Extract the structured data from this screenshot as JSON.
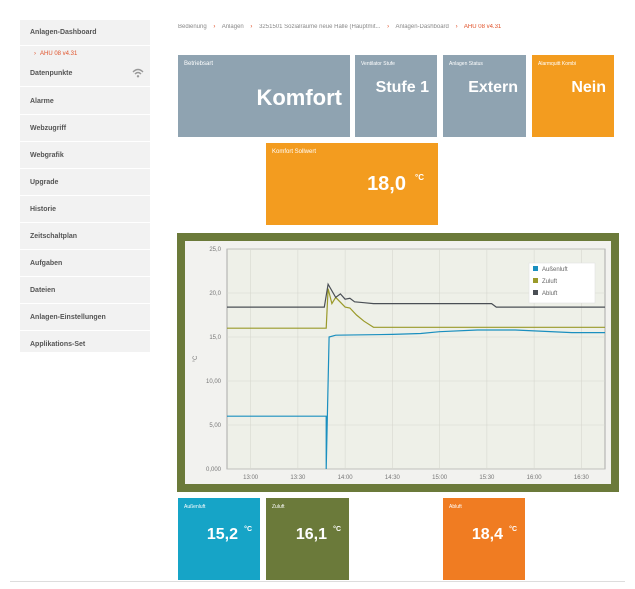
{
  "sidebar": {
    "items": [
      {
        "label": "Anlagen-Dashboard"
      },
      {
        "label": "AHU 08 v4.31",
        "sub": true
      },
      {
        "label": "Datenpunkte",
        "icon": "wifi-icon"
      },
      {
        "label": "Alarme"
      },
      {
        "label": "Webzugriff"
      },
      {
        "label": "Webgrafik"
      },
      {
        "label": "Upgrade"
      },
      {
        "label": "Historie"
      },
      {
        "label": "Zeitschaltplan"
      },
      {
        "label": "Aufgaben"
      },
      {
        "label": "Dateien"
      },
      {
        "label": "Anlagen-Einstellungen"
      },
      {
        "label": "Applikations-Set"
      }
    ]
  },
  "breadcrumb": {
    "items": [
      "Bedienung",
      "Anlagen",
      "3251501 Sozialräume neue Halle (Hauptmit...",
      "Anlagen-Dashboard",
      "AHU 08 v4.31"
    ]
  },
  "tiles": {
    "betriebsart": {
      "label": "Betriebsart",
      "value": "Komfort"
    },
    "luefter": {
      "label": "Ventilator Stufe",
      "value": "Stufe 1"
    },
    "anlagenstatus": {
      "label": "Anlagen Status",
      "value": "Extern"
    },
    "alarm": {
      "label": "Alarmquitt Kombi",
      "value": "Nein"
    },
    "sollwert": {
      "label": "Komfort Sollwert",
      "value": "18,0",
      "unit": "°C"
    },
    "aussenluft": {
      "label": "Außenluft",
      "value": "15,2",
      "unit": "°C"
    },
    "zuluft": {
      "label": "Zuluft",
      "value": "16,1",
      "unit": "°C"
    },
    "abluft": {
      "label": "Abluft",
      "value": "18,4",
      "unit": "°C"
    }
  },
  "colors": {
    "grey_tile": "#8fa3b1",
    "orange": "#f39c1f",
    "blue": "#16a4c7",
    "olive": "#6b7a3a",
    "dark_orange": "#f07c22",
    "accent_red": "#e0522a"
  },
  "chart_data": {
    "type": "line",
    "ylabel": "°C",
    "y_ticks": [
      "0,000",
      "5,00",
      "10,00",
      "15,0",
      "20,0",
      "25,0"
    ],
    "ylim": [
      0,
      25
    ],
    "x_ticks": [
      "13:00",
      "13:30",
      "14:00",
      "14:30",
      "15:00",
      "15:30",
      "16:00",
      "16:30"
    ],
    "xlim": [
      12.75,
      16.75
    ],
    "grid": true,
    "legend_position": "top-right",
    "series": [
      {
        "name": "Außenluft",
        "color": "#1a8fbf",
        "x": [
          12.75,
          13.75,
          13.8,
          13.8,
          13.83,
          13.9,
          14.5,
          14.8,
          15.0,
          15.4,
          15.8,
          16.4,
          16.75
        ],
        "y": [
          6.0,
          6.0,
          6.0,
          0.0,
          15.0,
          15.2,
          15.3,
          15.4,
          15.6,
          15.8,
          15.8,
          15.5,
          15.5
        ]
      },
      {
        "name": "Zuluft",
        "color": "#9a9a2a",
        "x": [
          12.75,
          13.8,
          13.82,
          13.86,
          13.9,
          14.0,
          14.05,
          14.12,
          14.2,
          14.3,
          16.75
        ],
        "y": [
          16.0,
          16.0,
          20.5,
          18.8,
          19.5,
          18.4,
          18.3,
          17.5,
          16.8,
          16.1,
          16.1
        ]
      },
      {
        "name": "Abluft",
        "color": "#4a4f55",
        "x": [
          12.75,
          13.78,
          13.82,
          13.9,
          13.95,
          14.0,
          14.05,
          14.1,
          14.2,
          14.3,
          15.55,
          15.6,
          16.75
        ],
        "y": [
          18.4,
          18.4,
          21.0,
          19.5,
          19.9,
          19.3,
          19.4,
          19.0,
          18.9,
          18.8,
          18.8,
          18.4,
          18.4
        ]
      }
    ]
  }
}
